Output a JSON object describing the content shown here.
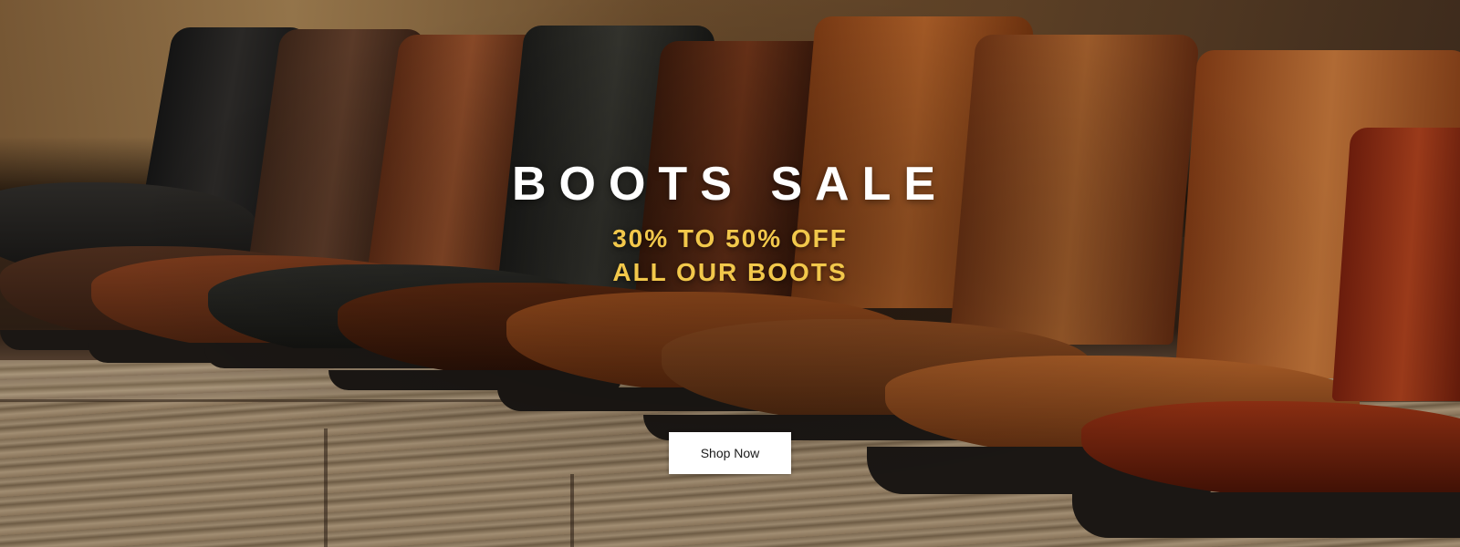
{
  "hero": {
    "title": "BOOTS SALE",
    "subtitle_line1": "30% TO 50% OFF",
    "subtitle_line2": "ALL OUR BOOTS",
    "button_label": "Shop Now",
    "image": "row of leather lace-up boots on wooden shelf",
    "colors": {
      "title": "#ffffff",
      "subtitle": "#f2c84b",
      "button_bg": "#ffffff",
      "button_text": "#1a1a1a"
    }
  }
}
